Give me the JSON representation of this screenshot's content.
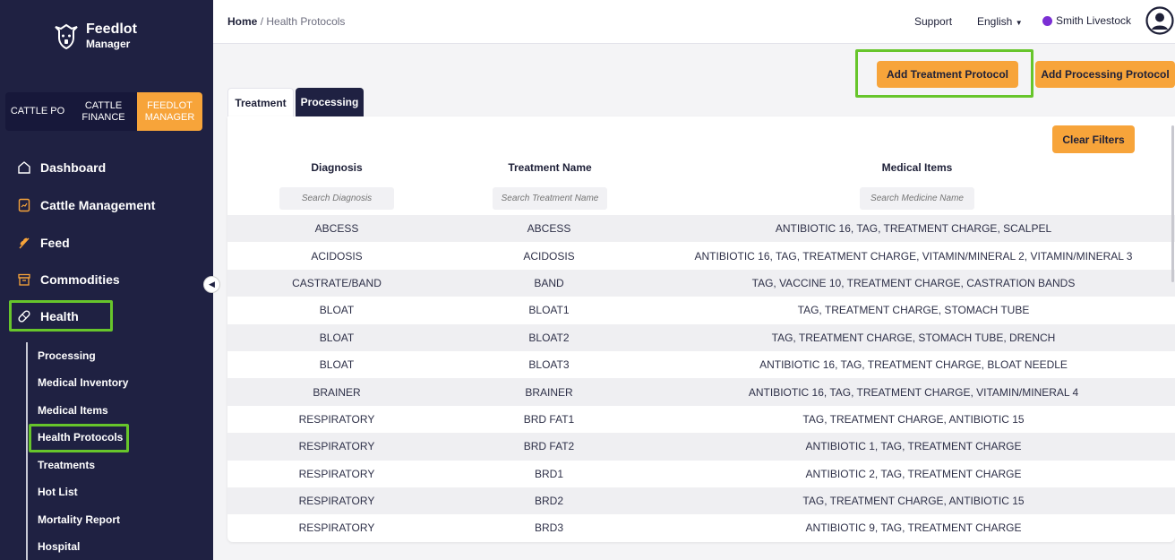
{
  "app": {
    "brand_line1": "Feedlot",
    "brand_line2": "Manager"
  },
  "switcher": {
    "items": [
      {
        "label": "CATTLE PO"
      },
      {
        "label": "CATTLE FINANCE"
      },
      {
        "label": "FEEDLOT MANAGER"
      }
    ],
    "active": "FEEDLOT MANAGER"
  },
  "nav": {
    "items": [
      {
        "label": "Dashboard",
        "icon": "home-icon"
      },
      {
        "label": "Cattle Management",
        "icon": "clipboard-icon"
      },
      {
        "label": "Feed",
        "icon": "wheat-icon"
      },
      {
        "label": "Commodities",
        "icon": "archive-icon"
      },
      {
        "label": "Health",
        "icon": "pill-icon"
      }
    ],
    "health_sub": [
      {
        "label": "Processing"
      },
      {
        "label": "Medical Inventory"
      },
      {
        "label": "Medical Items"
      },
      {
        "label": "Health Protocols"
      },
      {
        "label": "Treatments"
      },
      {
        "label": "Hot List"
      },
      {
        "label": "Mortality Report"
      },
      {
        "label": "Hospital"
      }
    ]
  },
  "topbar": {
    "breadcrumb_home": "Home",
    "breadcrumb_sep": "/",
    "breadcrumb_current": "Health Protocols",
    "support": "Support",
    "language": "English",
    "account": "Smith Livestock"
  },
  "actions": {
    "add_treatment": "Add Treatment Protocol",
    "add_processing": "Add Processing Protocol",
    "clear_filters": "Clear Filters"
  },
  "tabs": [
    {
      "label": "Treatment"
    },
    {
      "label": "Processing"
    }
  ],
  "table": {
    "headers": [
      "Diagnosis",
      "Treatment Name",
      "Medical Items"
    ],
    "search_placeholders": [
      "Search Diagnosis",
      "Search Treatment Name",
      "Search Medicine Name"
    ],
    "rows": [
      [
        "ABCESS",
        "ABCESS",
        "ANTIBIOTIC 16, TAG, TREATMENT CHARGE, SCALPEL"
      ],
      [
        "ACIDOSIS",
        "ACIDOSIS",
        "ANTIBIOTIC 16, TAG, TREATMENT CHARGE, VITAMIN/MINERAL 2, VITAMIN/MINERAL 3"
      ],
      [
        "CASTRATE/BAND",
        "BAND",
        "TAG, VACCINE 10, TREATMENT CHARGE, CASTRATION BANDS"
      ],
      [
        "BLOAT",
        "BLOAT1",
        "TAG, TREATMENT CHARGE, STOMACH TUBE"
      ],
      [
        "BLOAT",
        "BLOAT2",
        "TAG, TREATMENT CHARGE, STOMACH TUBE, DRENCH"
      ],
      [
        "BLOAT",
        "BLOAT3",
        "ANTIBIOTIC 16, TAG, TREATMENT CHARGE, BLOAT NEEDLE"
      ],
      [
        "BRAINER",
        "BRAINER",
        "ANTIBIOTIC 16, TAG, TREATMENT CHARGE, VITAMIN/MINERAL 4"
      ],
      [
        "RESPIRATORY",
        "BRD FAT1",
        "TAG, TREATMENT CHARGE, ANTIBIOTIC 15"
      ],
      [
        "RESPIRATORY",
        "BRD FAT2",
        "ANTIBIOTIC 1, TAG, TREATMENT CHARGE"
      ],
      [
        "RESPIRATORY",
        "BRD1",
        "ANTIBIOTIC 2, TAG, TREATMENT CHARGE"
      ],
      [
        "RESPIRATORY",
        "BRD2",
        "TAG, TREATMENT CHARGE, ANTIBIOTIC 15"
      ],
      [
        "RESPIRATORY",
        "BRD3",
        "ANTIBIOTIC 9, TAG, TREATMENT CHARGE"
      ]
    ]
  },
  "colors": {
    "sidebar_bg": "#1f2142",
    "accent_orange": "#f7a43a",
    "highlight_green": "#67c52b",
    "account_dot": "#7b2fd4"
  }
}
